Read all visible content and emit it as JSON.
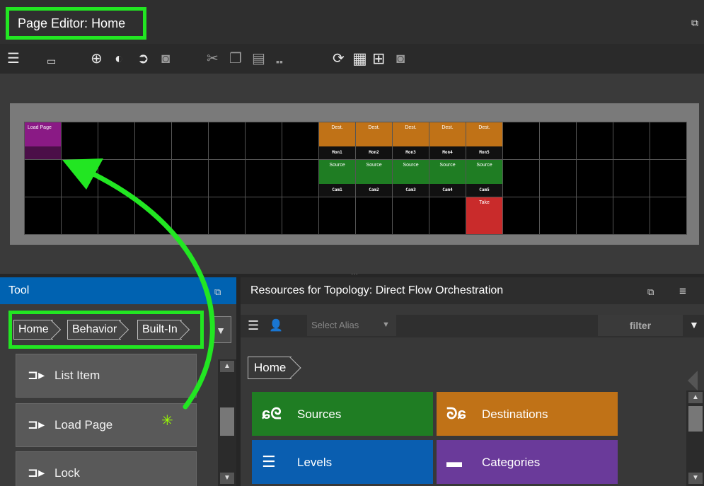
{
  "page_editor": {
    "title": "Page Editor: Home",
    "toolbar_icons": [
      "list-view-icon",
      "keyboard-icon",
      "add-icon",
      "remove-icon",
      "forward-icon",
      "script-icon",
      "cut-icon",
      "copy-icon",
      "paste-icon",
      "duplicate-icon",
      "refresh-icon",
      "grid-icon",
      "grid-outline-icon",
      "script-icon"
    ]
  },
  "grid": {
    "load_page": {
      "top": "Load Page",
      "bottom": ""
    },
    "dest_buttons": [
      {
        "top": "Dest.",
        "bottom": "Mon1"
      },
      {
        "top": "Dest.",
        "bottom": "Mon2"
      },
      {
        "top": "Dest.",
        "bottom": "Mon3"
      },
      {
        "top": "Dest.",
        "bottom": "Mon4"
      },
      {
        "top": "Dest.",
        "bottom": "Mon5"
      }
    ],
    "source_buttons": [
      {
        "top": "Source",
        "bottom": "Cam1"
      },
      {
        "top": "Source",
        "bottom": "Cam2"
      },
      {
        "top": "Source",
        "bottom": "Cam3"
      },
      {
        "top": "Source",
        "bottom": "Cam4"
      },
      {
        "top": "Source",
        "bottom": "Cam5"
      }
    ],
    "take_button": "Take"
  },
  "tool_panel": {
    "title": "Tool",
    "breadcrumb": [
      "Home",
      "Behavior",
      "Built-In"
    ],
    "items": [
      {
        "icon": "behavior-icon",
        "label": "List Item"
      },
      {
        "icon": "behavior-icon",
        "label": "Load Page"
      },
      {
        "icon": "behavior-icon",
        "label": "Lock"
      }
    ]
  },
  "resources_panel": {
    "title": "Resources for Topology: Direct Flow Orchestration",
    "alias_placeholder": "Select Alias",
    "filter_label": "filter",
    "breadcrumb": [
      "Home"
    ],
    "tiles": [
      {
        "label": "Sources",
        "color": "#1f7d23",
        "icon": "sources-icon"
      },
      {
        "label": "Destinations",
        "color": "#c07217",
        "icon": "destinations-icon"
      },
      {
        "label": "Levels",
        "color": "#0a5eb0",
        "icon": "levels-icon"
      },
      {
        "label": "Categories",
        "color": "#6a3a9a",
        "icon": "categories-icon"
      }
    ]
  },
  "colors": {
    "highlight": "#22e622",
    "tool_header": "#0062b1"
  }
}
